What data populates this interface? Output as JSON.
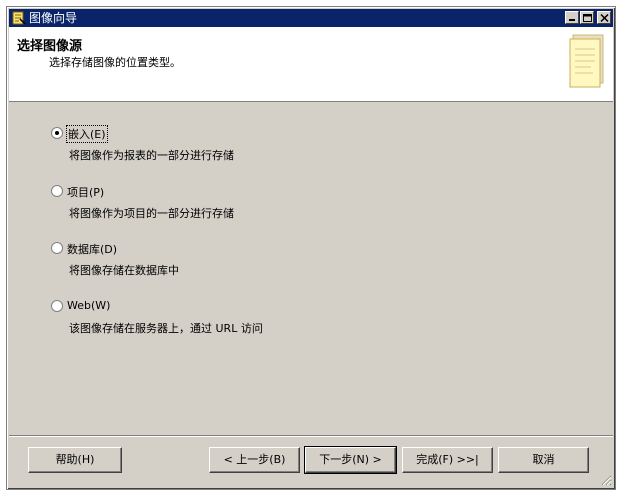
{
  "window": {
    "title": "图像向导"
  },
  "header": {
    "title": "选择图像源",
    "subtitle": "选择存储图像的位置类型。"
  },
  "options": [
    {
      "label": "嵌入(E)",
      "description": "将图像作为报表的一部分进行存储",
      "selected": true
    },
    {
      "label": "项目(P)",
      "description": "将图像作为项目的一部分进行存储",
      "selected": false
    },
    {
      "label": "数据库(D)",
      "description": "将图像存储在数据库中",
      "selected": false
    },
    {
      "label": "Web(W)",
      "description": "该图像存储在服务器上，通过 URL 访问",
      "selected": false
    }
  ],
  "buttons": {
    "help": "帮助(H)",
    "back": "< 上一步(B)",
    "next": "下一步(N) >",
    "finish": "完成(F) >>|",
    "cancel": "取消"
  },
  "icons": {
    "app": "wizard-icon",
    "minimize": "minimize-icon",
    "maximize": "maximize-icon",
    "close": "close-icon",
    "header": "document-icon"
  }
}
